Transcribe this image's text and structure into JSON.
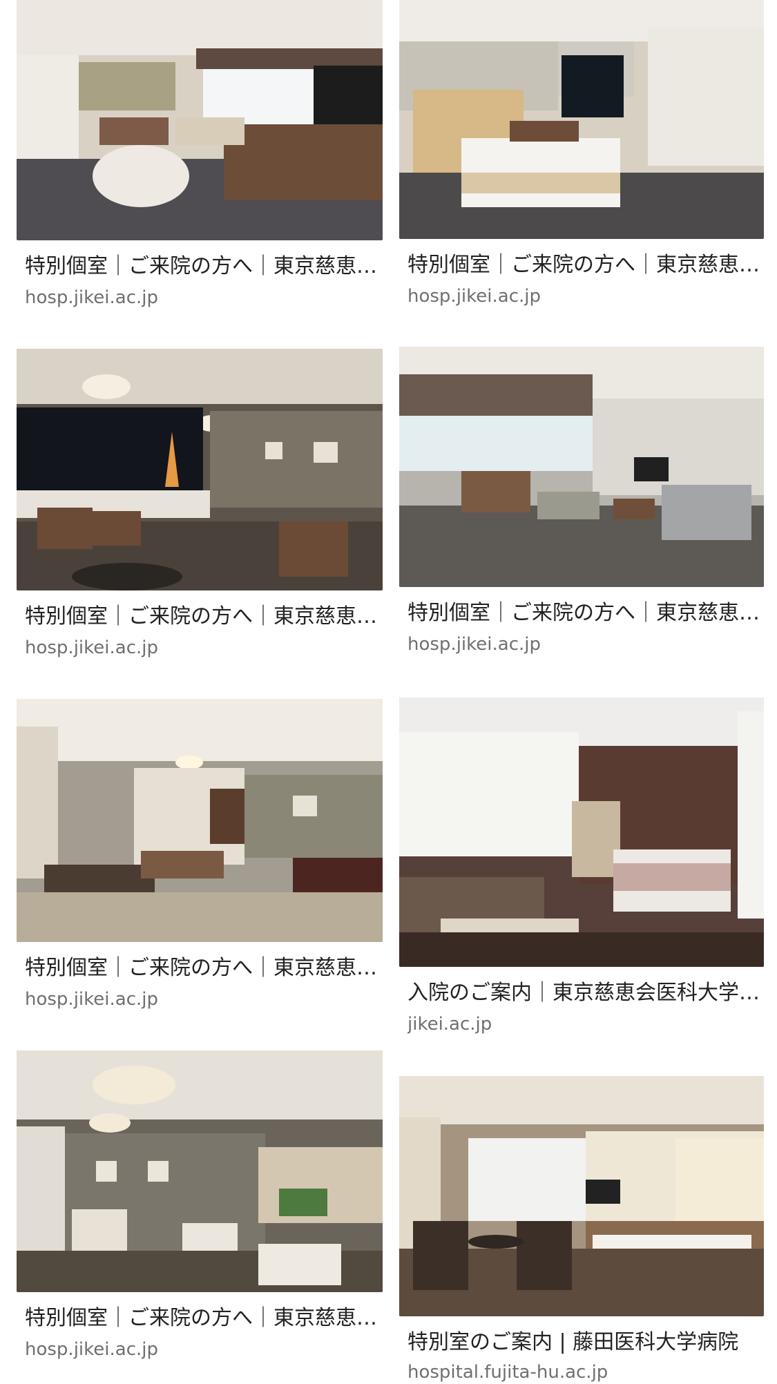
{
  "results": [
    {
      "title": "特別個室｜ご来院の方へ｜東京慈恵会医科大学附属病院",
      "domain": "hosp.jikei.ac.jp"
    },
    {
      "title": "特別個室｜ご来院の方へ｜東京慈恵会医科大学附属病院",
      "domain": "hosp.jikei.ac.jp"
    },
    {
      "title": "特別個室｜ご来院の方へ｜東京慈恵会医科大学附属病院",
      "domain": "hosp.jikei.ac.jp"
    },
    {
      "title": "特別個室｜ご来院の方へ｜東京慈恵会医科大学附属病院",
      "domain": "hosp.jikei.ac.jp"
    },
    {
      "title": "特別個室｜ご来院の方へ｜東京慈恵会医科大学附属病院",
      "domain": "hosp.jikei.ac.jp"
    },
    {
      "title": "入院のご案内｜東京慈恵会医科大学附属病院",
      "domain": "jikei.ac.jp"
    },
    {
      "title": "特別個室｜ご来院の方へ｜東京慈恵会医科大学附属病院",
      "domain": "hosp.jikei.ac.jp"
    },
    {
      "title": "特別室のご案内 | 藤田医科大学病院",
      "domain": "hospital.fujita-hu.ac.jp"
    }
  ]
}
